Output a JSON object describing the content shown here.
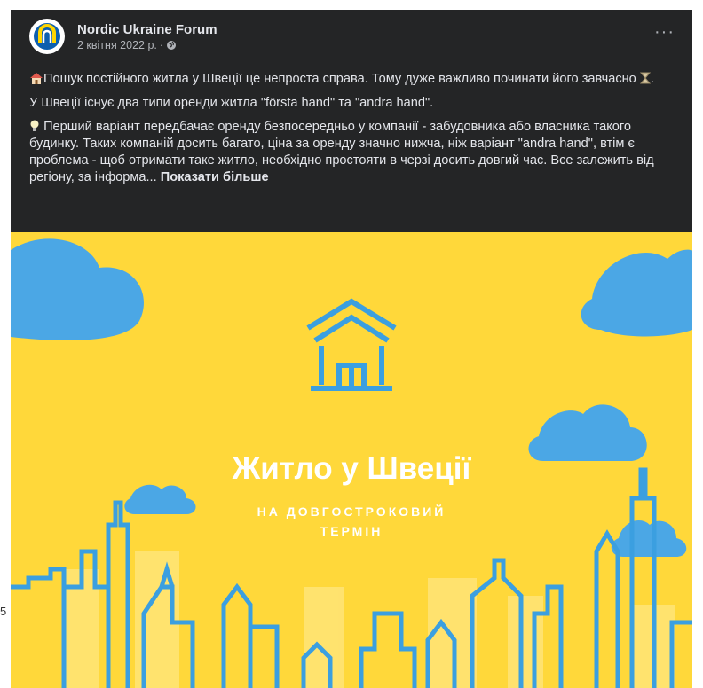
{
  "side_number": "5",
  "post": {
    "page_name": "Nordic Ukraine Forum",
    "date": "2 квітня 2022 р.",
    "separator": "·",
    "more_label": "···",
    "paragraph1": "Пошук постійного житла у Швеції це непроста справа. Тому дуже важливо починати його завчасно",
    "paragraph2": "У Швеції існує два типи оренди житла \"första hand\" та \"andra hand\".",
    "paragraph3": "Перший варіант передбачає оренду безпосередньо у компанії - забудовника або власника такого будинку. Таких компаній досить багато, ціна за оренду значно нижча, ніж варіант \"andra hand\", втім є проблема - щоб отримати таке житло, необхідно простояти в черзі досить довгий час. Все залежить від регіону, за інформа...",
    "see_more": "Показати більше"
  },
  "image": {
    "title": "Житло у Швеції",
    "subtitle_line1": "НА ДОВГОСТРОКОВИЙ",
    "subtitle_line2": "ТЕРМІН",
    "colors": {
      "background": "#ffd83a",
      "blue": "#3b9fe0",
      "cloud": "#4ba7e5"
    }
  }
}
